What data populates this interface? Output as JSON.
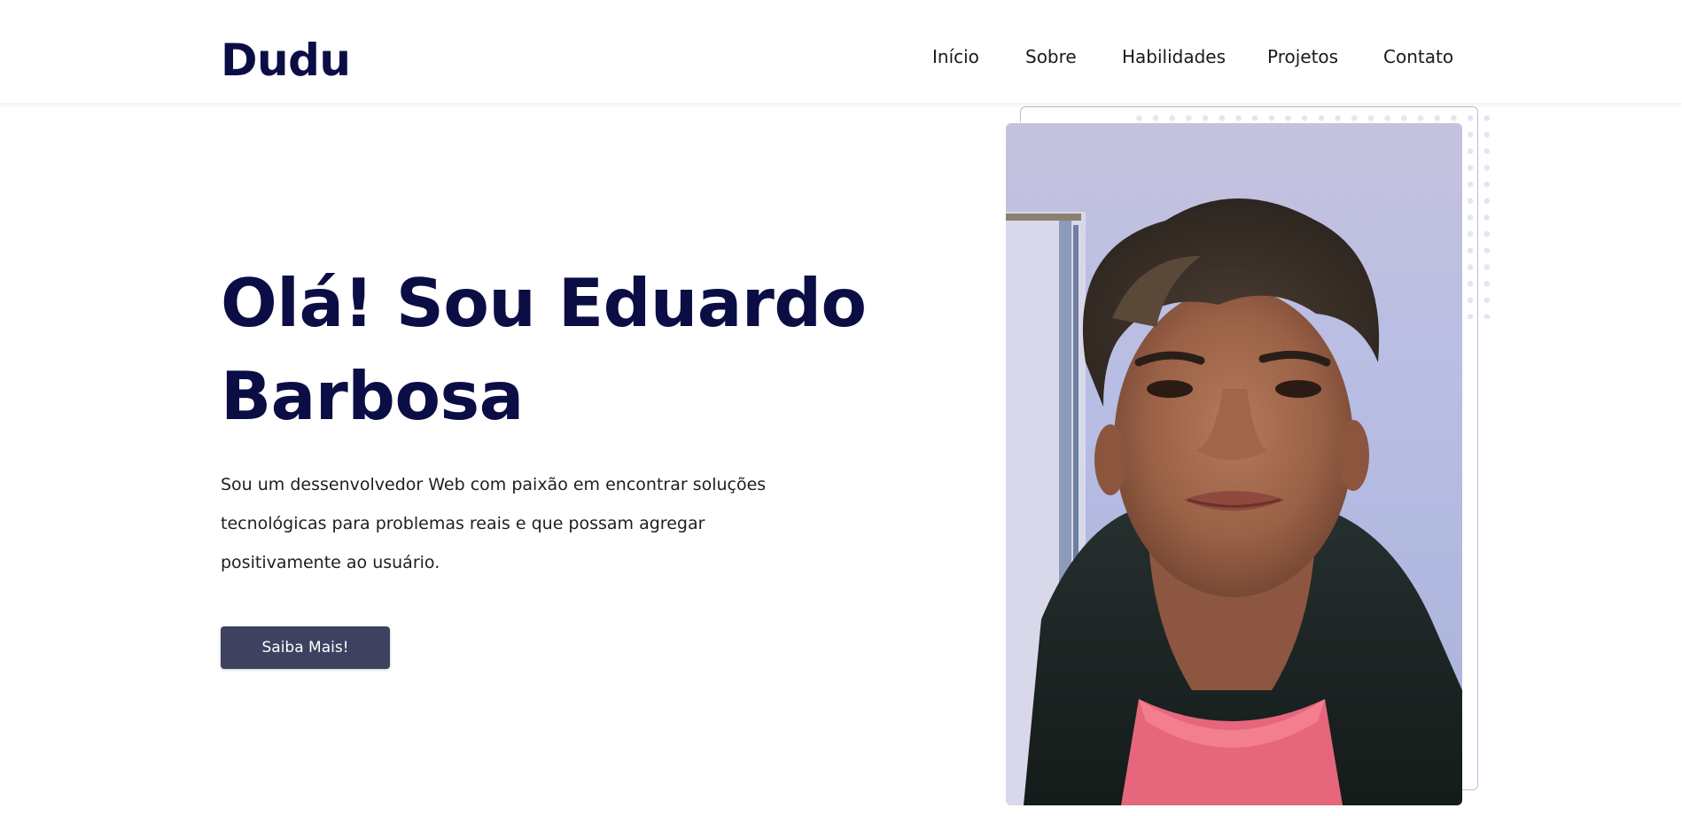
{
  "header": {
    "logo": "Dudu",
    "nav": [
      {
        "label": "Início"
      },
      {
        "label": "Sobre"
      },
      {
        "label": "Habilidades"
      },
      {
        "label": "Projetos"
      },
      {
        "label": "Contato"
      }
    ]
  },
  "hero": {
    "title": "Olá! Sou Eduardo Barbosa",
    "description": "Sou um dessenvolvedor Web com paixão em encontrar soluções tecnológicas para problemas reais e que possam agregar positivamente ao usuário.",
    "cta_label": "Saiba Mais!",
    "photo_icon": "portrait-photo"
  },
  "colors": {
    "primary_text": "#0b0d45",
    "button_bg": "#3e4260",
    "frame_border": "#b7bedb",
    "dots": "#e3e6ee"
  }
}
